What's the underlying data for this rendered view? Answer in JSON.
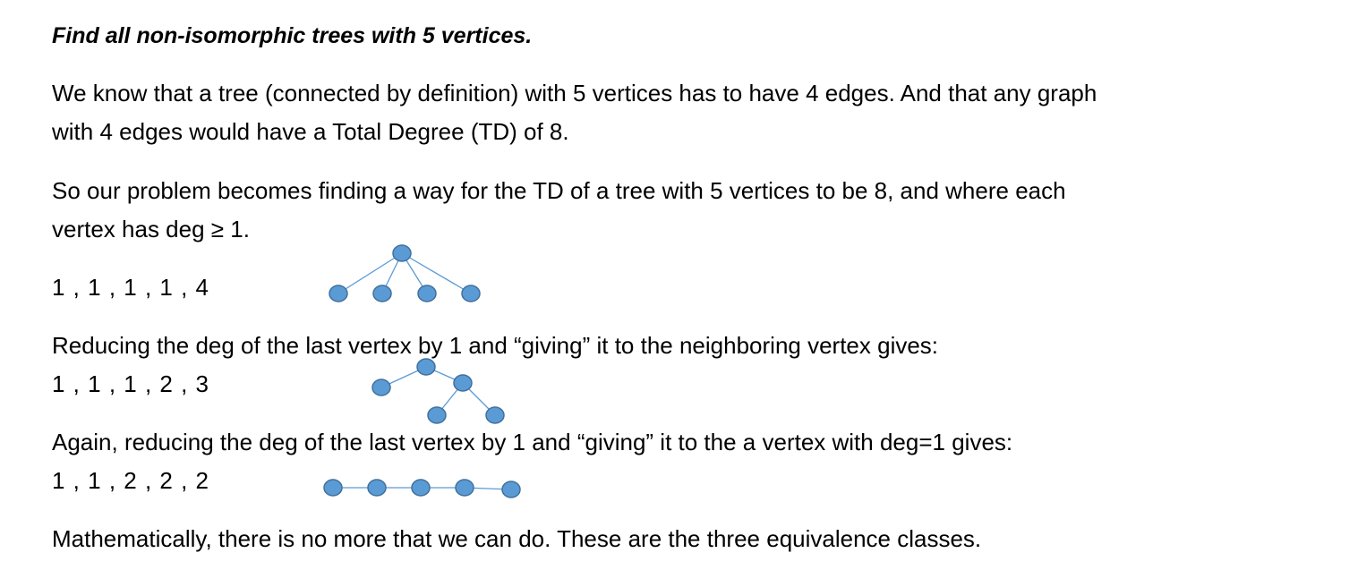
{
  "document": {
    "title": "Find all non-isomorphic trees with 5 vertices.",
    "intro_line_1": "We know that a tree (connected by definition) with 5 vertices has to have 4 edges.  And that any graph",
    "intro_line_2": "with 4 edges would have a Total Degree (TD) of 8.",
    "problem_line_1": "So our problem becomes finding a way for the TD of a tree with 5 vertices to be 8, and where each",
    "problem_line_2": "vertex has deg ≥ 1.",
    "seq_1": "1 , 1 , 1 , 1 , 4",
    "reduce_text_1": "Reducing the deg of the last vertex by 1 and “giving” it to the neighboring vertex gives:",
    "seq_2": "1 , 1 , 1 , 2 , 3",
    "reduce_text_2": "Again, reducing the deg of the last vertex by 1 and “giving” it to the a vertex with deg=1 gives:",
    "seq_3": "1 , 1 , 2 , 2 , 2",
    "conclusion": "Mathematically, there is no more that we can do.  These are the three equivalence classes."
  },
  "trees": [
    {
      "degree_sequence": [
        1,
        1,
        1,
        1,
        4
      ],
      "shape": "star"
    },
    {
      "degree_sequence": [
        1,
        1,
        1,
        2,
        3
      ],
      "shape": "spider"
    },
    {
      "degree_sequence": [
        1,
        1,
        2,
        2,
        2
      ],
      "shape": "path"
    }
  ],
  "colors": {
    "vertex_fill": "#5b9bd5",
    "vertex_stroke": "#41719c",
    "edge": "#5b9bd5"
  }
}
